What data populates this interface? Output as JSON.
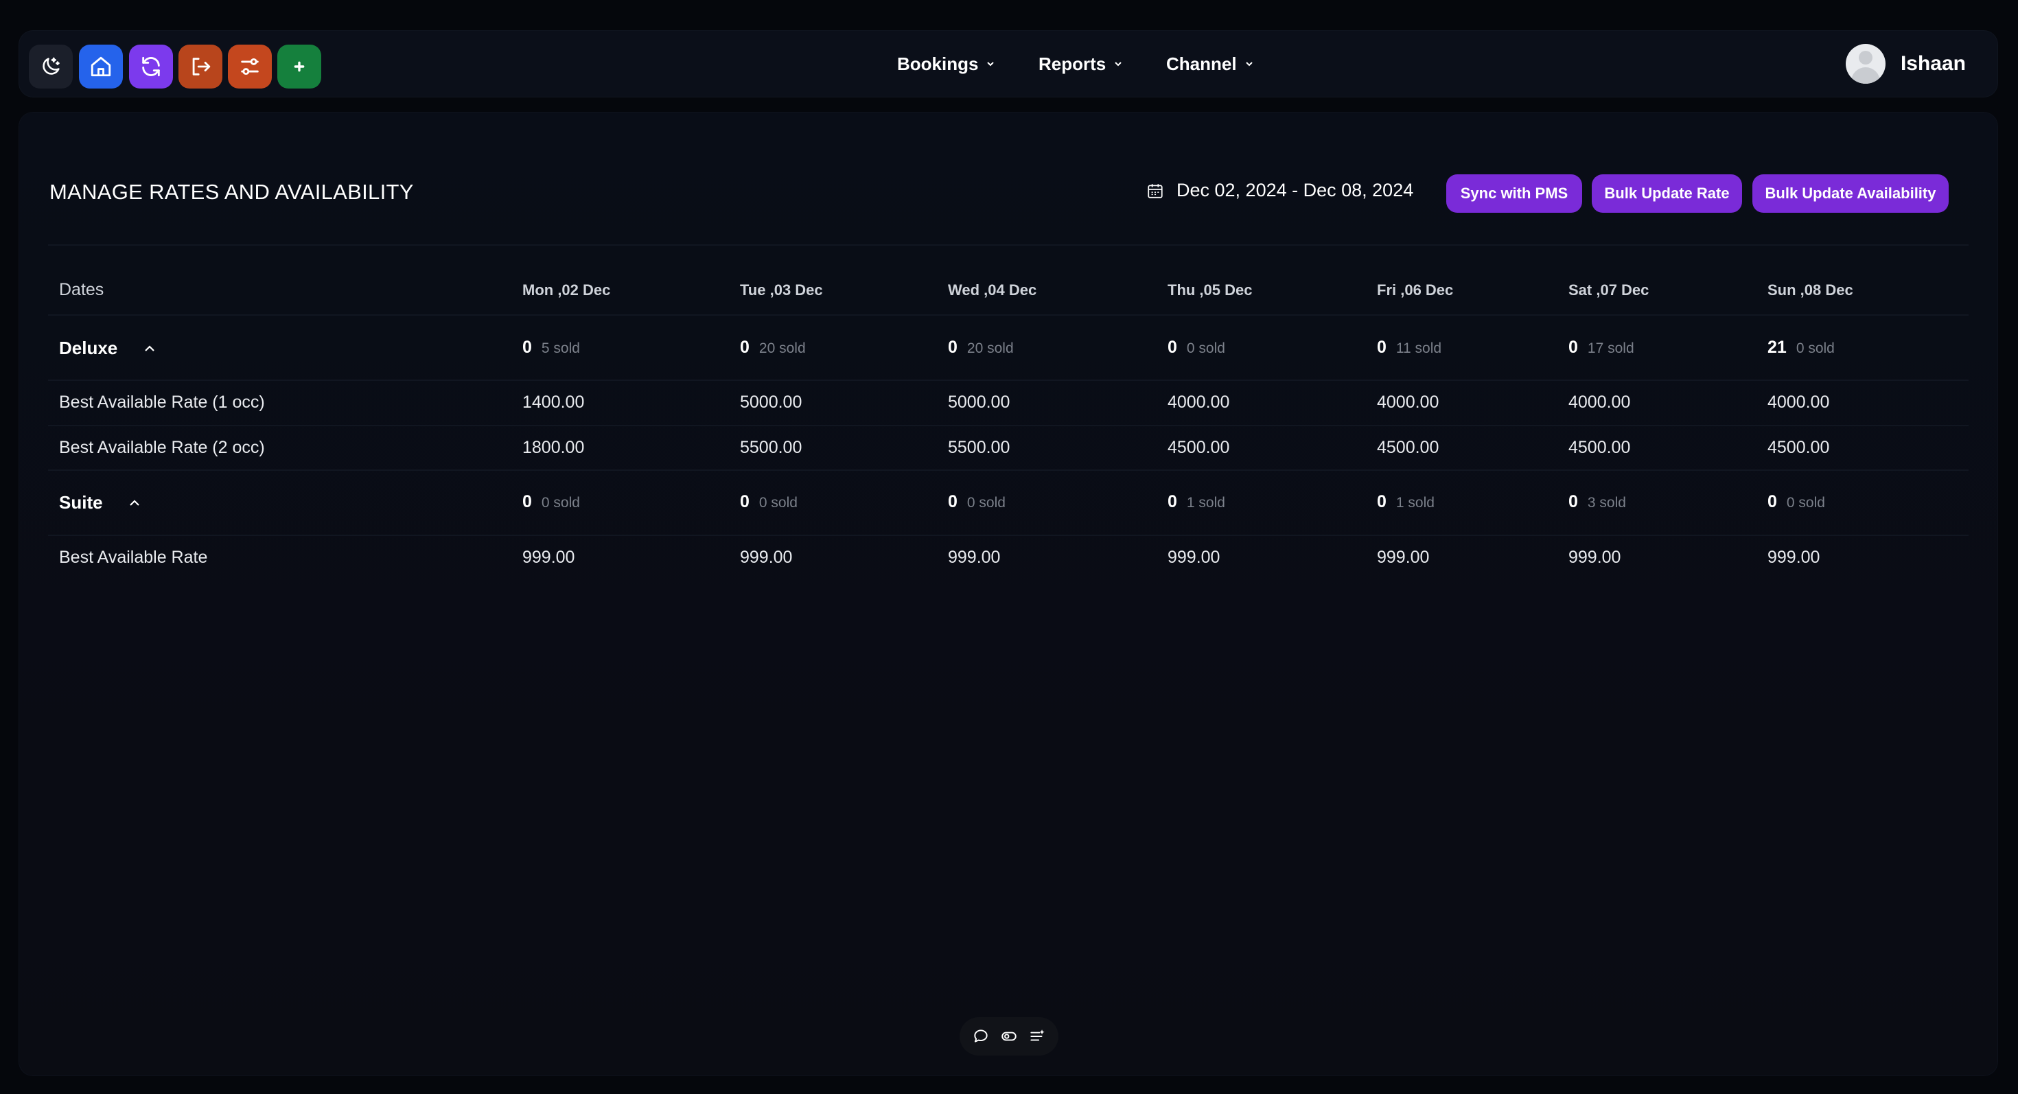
{
  "colors": {
    "theme_btn": "#1b1f2a",
    "home_btn": "#2563eb",
    "sync_btn": "#7c3aed",
    "logout_btn": "#b8451c",
    "settings_btn": "#c4471e",
    "add_btn": "#15803d",
    "primary": "#7a2bd8"
  },
  "nav": {
    "bookings": "Bookings",
    "reports": "Reports",
    "channel": "Channel"
  },
  "user": {
    "name": "Ishaan"
  },
  "page": {
    "title": "MANAGE RATES AND AVAILABILITY",
    "date_range": "Dec 02, 2024 - Dec 08, 2024",
    "buttons": {
      "sync": "Sync with PMS",
      "bulk_rate": "Bulk Update Rate",
      "bulk_availability": "Bulk Update Availability"
    }
  },
  "table": {
    "dates_header": "Dates",
    "days": [
      "Mon ,02 Dec",
      "Tue ,03 Dec",
      "Wed ,04 Dec",
      "Thu ,05 Dec",
      "Fri ,06 Dec",
      "Sat ,07 Dec",
      "Sun ,08 Dec"
    ],
    "room_types": [
      {
        "name": "Deluxe",
        "availability": [
          "0",
          "0",
          "0",
          "0",
          "0",
          "0",
          "21"
        ],
        "sold": [
          "5 sold",
          "20 sold",
          "20 sold",
          "0 sold",
          "11 sold",
          "17 sold",
          "0 sold"
        ],
        "rate_plans": [
          {
            "name": "Best Available Rate (1 occ)",
            "rates": [
              "1400.00",
              "5000.00",
              "5000.00",
              "4000.00",
              "4000.00",
              "4000.00",
              "4000.00"
            ]
          },
          {
            "name": "Best Available Rate (2 occ)",
            "rates": [
              "1800.00",
              "5500.00",
              "5500.00",
              "4500.00",
              "4500.00",
              "4500.00",
              "4500.00"
            ]
          }
        ]
      },
      {
        "name": "Suite",
        "availability": [
          "0",
          "0",
          "0",
          "0",
          "0",
          "0",
          "0"
        ],
        "sold": [
          "0 sold",
          "0 sold",
          "0 sold",
          "1 sold",
          "1 sold",
          "3 sold",
          "0 sold"
        ],
        "rate_plans": [
          {
            "name": "Best Available Rate",
            "rates": [
              "999.00",
              "999.00",
              "999.00",
              "999.00",
              "999.00",
              "999.00",
              "999.00"
            ]
          }
        ]
      }
    ]
  }
}
